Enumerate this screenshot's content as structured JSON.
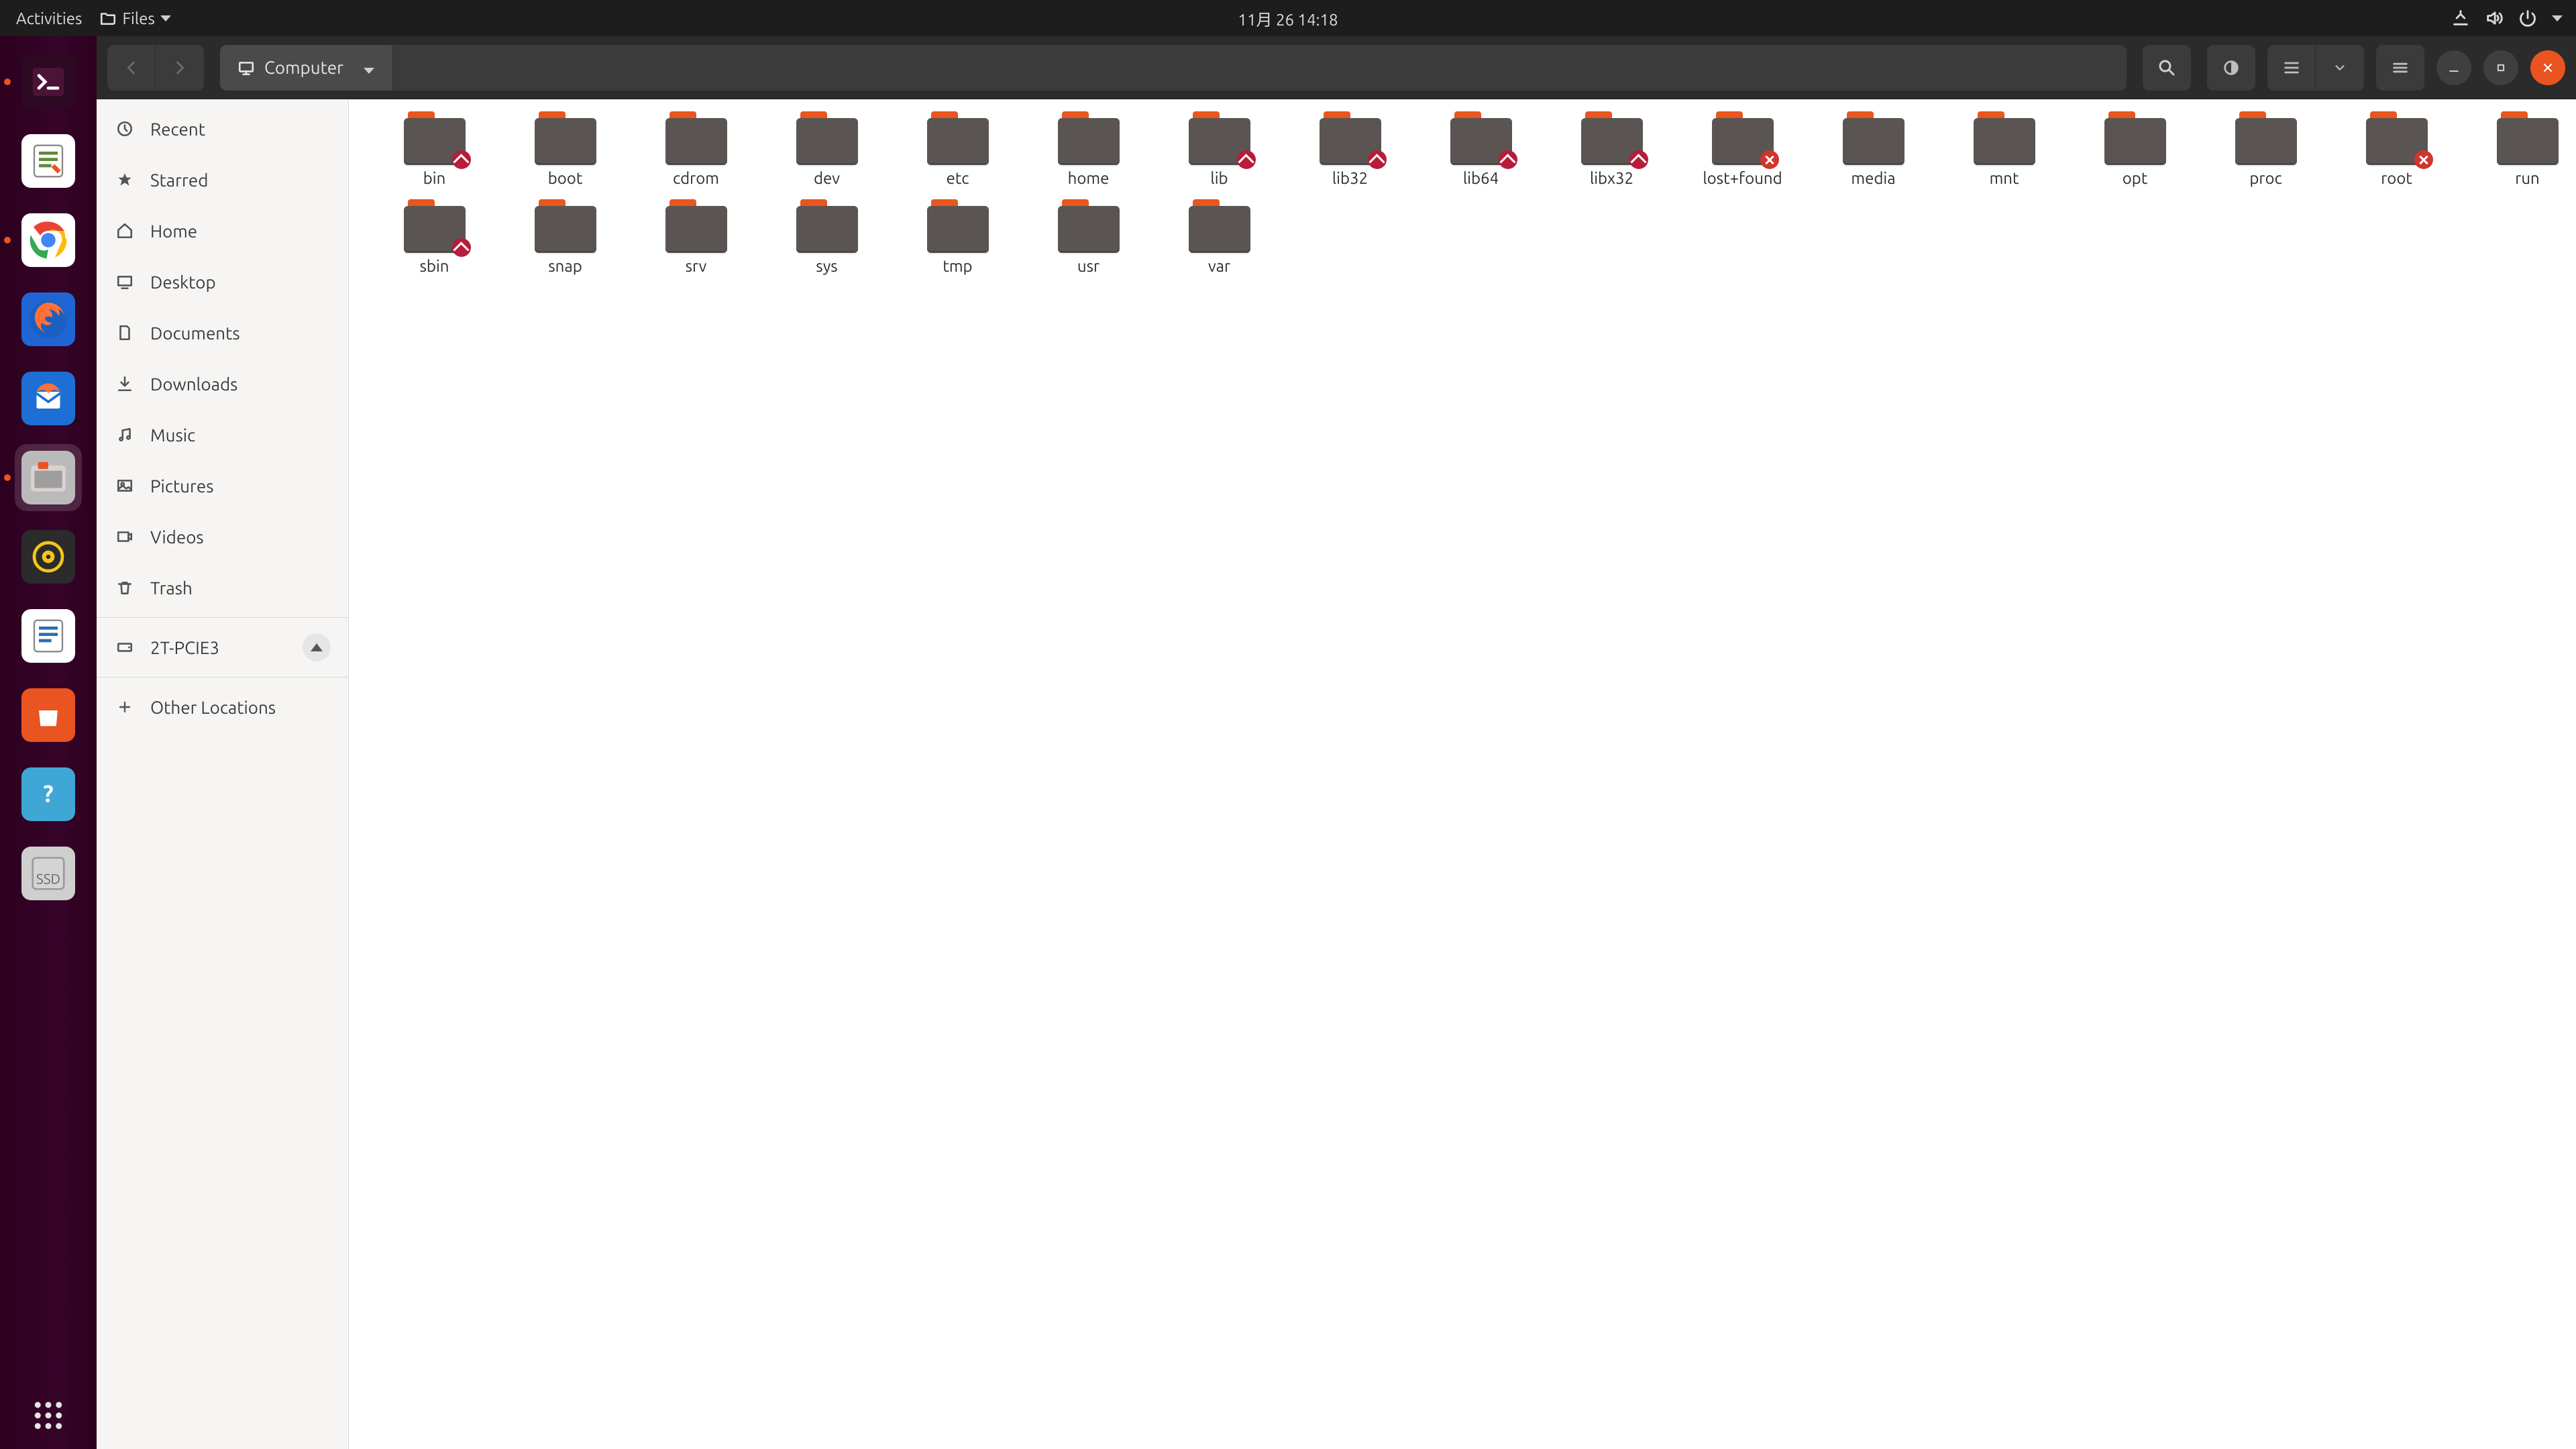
{
  "top_panel": {
    "activities": "Activities",
    "app_menu": "Files",
    "clock": "11月 26  14:18"
  },
  "dock": {
    "items": [
      {
        "name": "terminal",
        "running": true,
        "bg": "#2d0922",
        "glyph": "term"
      },
      {
        "name": "text-editor",
        "running": false,
        "bg": "#ffffff",
        "glyph": "gedit"
      },
      {
        "name": "chrome",
        "running": true,
        "bg": "#ffffff",
        "glyph": "chrome"
      },
      {
        "name": "firefox",
        "running": false,
        "bg": "#1f66d4",
        "glyph": "firefox"
      },
      {
        "name": "thunderbird",
        "running": false,
        "bg": "#1e6ed6",
        "glyph": "mail"
      },
      {
        "name": "files",
        "running": true,
        "active": true,
        "bg": "#bababa",
        "glyph": "files"
      },
      {
        "name": "rhythmbox",
        "running": false,
        "bg": "#2b2b2b",
        "glyph": "music"
      },
      {
        "name": "libreoffice",
        "running": false,
        "bg": "#ffffff",
        "glyph": "writer"
      },
      {
        "name": "software",
        "running": false,
        "bg": "#e95420",
        "glyph": "bag"
      },
      {
        "name": "help",
        "running": false,
        "bg": "#3fa7d6",
        "glyph": "help"
      },
      {
        "name": "disk-ssd",
        "running": false,
        "bg": "#cfcfcf",
        "glyph": "ssd",
        "label": "SSD"
      }
    ],
    "show_apps": "show-applications"
  },
  "toolbar": {
    "location_icon": "computer",
    "location_label": "Computer"
  },
  "sidebar": {
    "places": [
      {
        "icon": "recent",
        "label": "Recent"
      },
      {
        "icon": "star",
        "label": "Starred"
      },
      {
        "icon": "home",
        "label": "Home"
      },
      {
        "icon": "desktop",
        "label": "Desktop"
      },
      {
        "icon": "documents",
        "label": "Documents"
      },
      {
        "icon": "downloads",
        "label": "Downloads"
      },
      {
        "icon": "music",
        "label": "Music"
      },
      {
        "icon": "pictures",
        "label": "Pictures"
      },
      {
        "icon": "videos",
        "label": "Videos"
      },
      {
        "icon": "trash",
        "label": "Trash"
      }
    ],
    "devices": [
      {
        "icon": "drive",
        "label": "2T-PCIE3",
        "ejectable": true
      }
    ],
    "other_locations": "Other Locations"
  },
  "folders": [
    {
      "name": "bin",
      "badge": "link"
    },
    {
      "name": "boot",
      "badge": null
    },
    {
      "name": "cdrom",
      "badge": null
    },
    {
      "name": "dev",
      "badge": null
    },
    {
      "name": "etc",
      "badge": null
    },
    {
      "name": "home",
      "badge": null
    },
    {
      "name": "lib",
      "badge": "link"
    },
    {
      "name": "lib32",
      "badge": "link"
    },
    {
      "name": "lib64",
      "badge": "link"
    },
    {
      "name": "libx32",
      "badge": "link"
    },
    {
      "name": "lost+found",
      "badge": "denied"
    },
    {
      "name": "media",
      "badge": null
    },
    {
      "name": "mnt",
      "badge": null
    },
    {
      "name": "opt",
      "badge": null
    },
    {
      "name": "proc",
      "badge": null
    },
    {
      "name": "root",
      "badge": "denied"
    },
    {
      "name": "run",
      "badge": null
    },
    {
      "name": "sbin",
      "badge": "link"
    },
    {
      "name": "snap",
      "badge": null
    },
    {
      "name": "srv",
      "badge": null
    },
    {
      "name": "sys",
      "badge": null
    },
    {
      "name": "tmp",
      "badge": null
    },
    {
      "name": "usr",
      "badge": null
    },
    {
      "name": "var",
      "badge": null
    }
  ]
}
